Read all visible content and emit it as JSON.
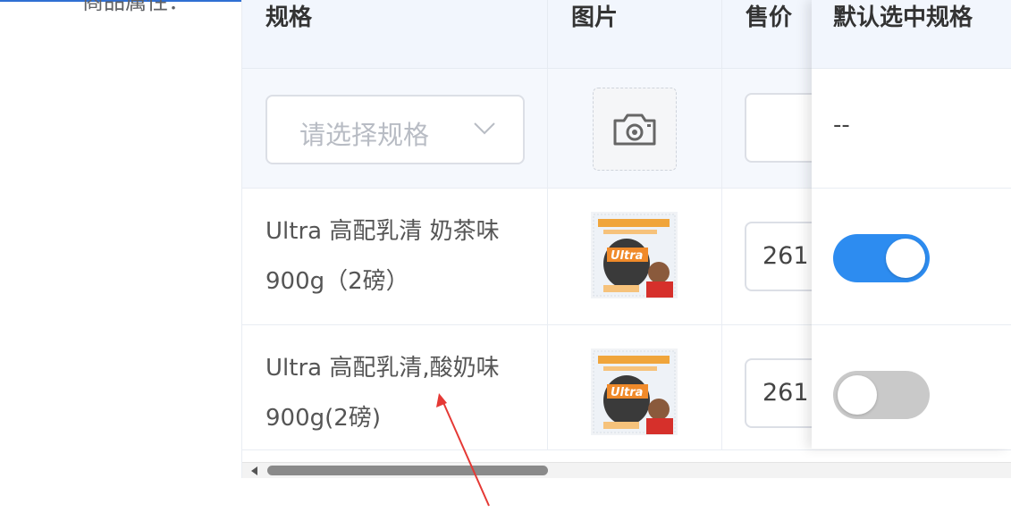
{
  "form": {
    "label": "商品属性："
  },
  "table": {
    "columns": [
      "规格",
      "图片",
      "售价",
      "默认选中规格"
    ],
    "new_row": {
      "spec_placeholder": "请选择规格",
      "default_text": "--"
    },
    "rows": [
      {
        "spec_line1": "Ultra 高配乳清 奶茶味",
        "spec_line2": "900g（2磅）",
        "price": "261",
        "default_selected": true
      },
      {
        "spec_line1": "Ultra 高配乳清,酸奶味",
        "spec_line2": "900g(2磅)",
        "price": "261",
        "default_selected": false
      }
    ]
  },
  "colors": {
    "accent": "#2d8cf0",
    "annotation_arrow": "#e53935"
  },
  "icons": {
    "upload": "camera-icon",
    "dropdown": "chevron-down-icon"
  }
}
